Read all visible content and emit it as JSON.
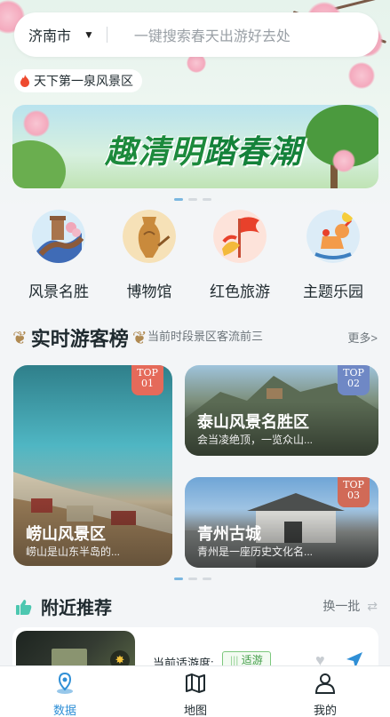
{
  "header": {
    "city": "济南市",
    "search_placeholder": "一键搜索春天出游好去处",
    "chip_label": "天下第一泉风景区"
  },
  "banner": {
    "title_part1": "趣清明",
    "title_part2": "踏春潮"
  },
  "categories": [
    {
      "label": "风景名胜",
      "icon": "great-wall-icon"
    },
    {
      "label": "博物馆",
      "icon": "museum-vase-icon"
    },
    {
      "label": "红色旅游",
      "icon": "red-flag-icon"
    },
    {
      "label": "主题乐园",
      "icon": "rocking-horse-icon"
    }
  ],
  "ranking": {
    "title": "实时游客榜",
    "subtitle": "当前时段景区客流前三",
    "more": "更多>",
    "items": [
      {
        "top": "TOP",
        "rank": "01",
        "name": "崂山风景区",
        "desc": "崂山是山东半岛的..."
      },
      {
        "top": "TOP",
        "rank": "02",
        "name": "泰山风景名胜区",
        "desc": "会当凌绝顶，一览众山..."
      },
      {
        "top": "TOP",
        "rank": "03",
        "name": "青州古城",
        "desc": "青州是一座历史文化名..."
      }
    ]
  },
  "nearby": {
    "title": "附近推荐",
    "refresh": "换一批",
    "item": {
      "label": "当前适游度:",
      "badge": "适游"
    }
  },
  "tabbar": {
    "tabs": [
      {
        "label": "数据",
        "active": true
      },
      {
        "label": "地图",
        "active": false
      },
      {
        "label": "我的",
        "active": false
      }
    ]
  },
  "colors": {
    "accent": "#2f8fd6",
    "rank1": "#e56a5a",
    "rank2": "#6f88c5",
    "rank3": "#d16a57",
    "badge_green": "#3e9a44"
  }
}
